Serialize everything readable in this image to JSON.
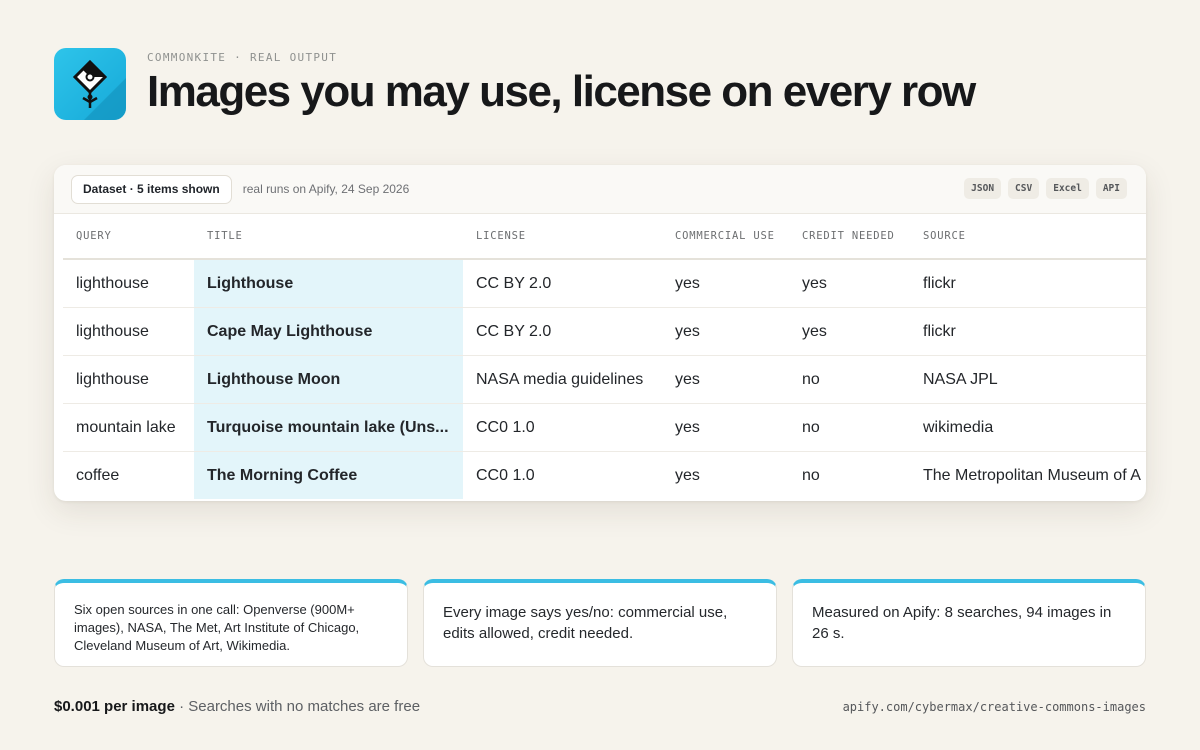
{
  "header": {
    "eyebrow": "COMMONKITE · REAL OUTPUT",
    "title": "Images you may use, license on every row",
    "logo_icon": "kite-icon",
    "logo_color": "#22b8e6"
  },
  "dataset": {
    "pill_label": "Dataset · 5 items shown",
    "note": "real runs on Apify, 24 Sep 2026",
    "formats": [
      "JSON",
      "CSV",
      "Excel",
      "API"
    ],
    "columns": [
      "QUERY",
      "TITLE",
      "LICENSE",
      "COMMERCIAL USE",
      "CREDIT NEEDED",
      "SOURCE"
    ],
    "rows": [
      {
        "query": "lighthouse",
        "title": "Lighthouse",
        "license": "CC BY 2.0",
        "commercial": "yes",
        "credit": "yes",
        "source": "flickr"
      },
      {
        "query": "lighthouse",
        "title": "Cape May Lighthouse",
        "license": "CC BY 2.0",
        "commercial": "yes",
        "credit": "yes",
        "source": "flickr"
      },
      {
        "query": "lighthouse",
        "title": "Lighthouse Moon",
        "license": "NASA media guidelines",
        "commercial": "yes",
        "credit": "no",
        "source": "NASA JPL"
      },
      {
        "query": "mountain lake",
        "title": "Turquoise mountain lake (Uns...",
        "license": "CC0 1.0",
        "commercial": "yes",
        "credit": "no",
        "source": "wikimedia"
      },
      {
        "query": "coffee",
        "title": "The Morning Coffee",
        "license": "CC0 1.0",
        "commercial": "yes",
        "credit": "no",
        "source": "The Metropolitan Museum of A"
      }
    ],
    "title_highlight_color": "#e3f5fa"
  },
  "features": [
    "Six open sources in one call: Openverse (900M+ images), NASA, The Met, Art Institute of Chicago, Cleveland Museum of Art, Wikimedia.",
    "Every image says yes/no: commercial use, edits allowed, credit needed.",
    "Measured on Apify: 8 searches, 94 images in 26 s."
  ],
  "footer": {
    "price": "$0.001 per image",
    "price_note": " · Searches with no matches are free",
    "url": "apify.com/cybermax/creative-commons-images"
  },
  "accent_color": "#3bbde3"
}
